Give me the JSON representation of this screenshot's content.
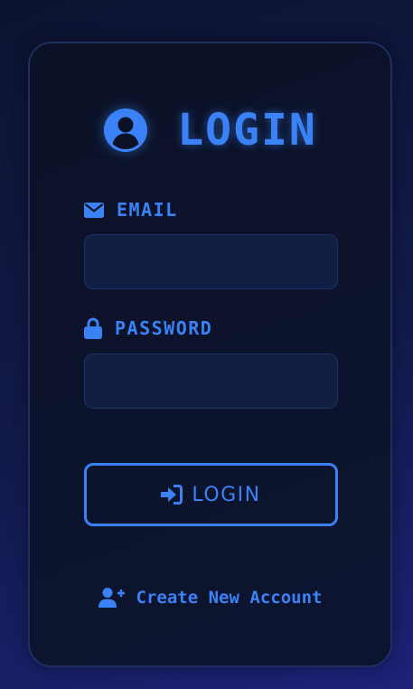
{
  "title": "LOGIN",
  "email": {
    "label": "EMAIL",
    "value": "",
    "icon": "envelope-icon"
  },
  "password": {
    "label": "PASSWORD",
    "value": "",
    "icon": "lock-icon"
  },
  "login_button": {
    "label": "LOGIN",
    "icon": "sign-in-icon"
  },
  "create_account": {
    "label": "Create New Account",
    "icon": "user-plus-icon"
  },
  "colors": {
    "accent": "#3b82f6",
    "card_background": "#0b1227",
    "input_background": "#111f44",
    "page_background": "#121a4a"
  }
}
